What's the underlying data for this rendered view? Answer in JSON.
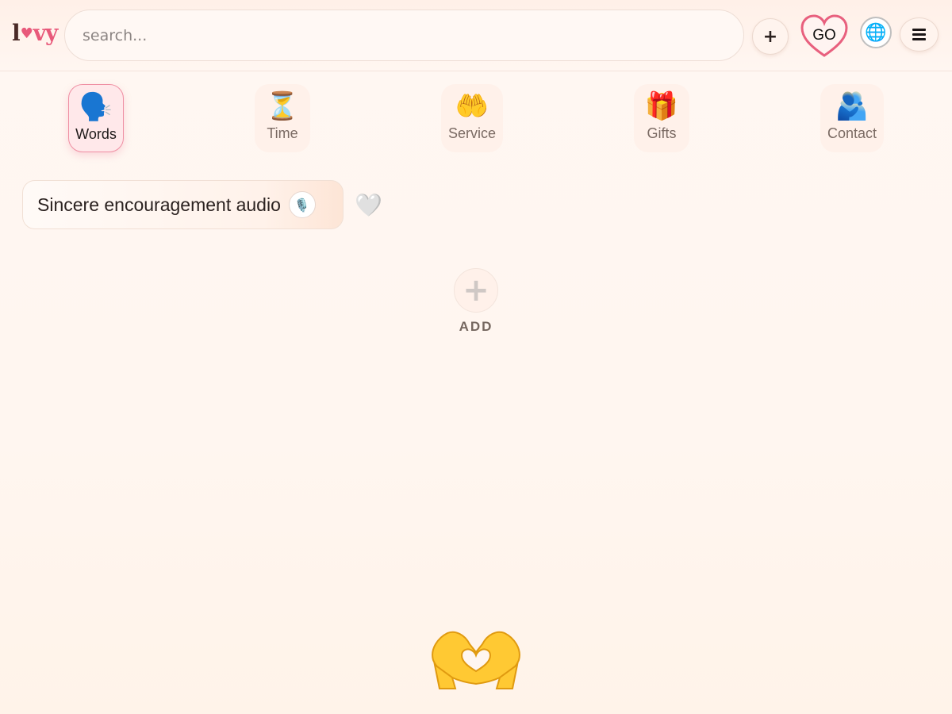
{
  "header": {
    "logo_l": "l",
    "logo_heart": "♥",
    "logo_rest": "vy",
    "search_placeholder": "search...",
    "plus_label": "+",
    "go_label": "GO",
    "globe_icon": "🌐"
  },
  "categories": [
    {
      "emoji": "🗣️",
      "label": "Words",
      "active": true
    },
    {
      "emoji": "⏳",
      "label": "Time",
      "active": false
    },
    {
      "emoji": "🤲",
      "label": "Service",
      "active": false
    },
    {
      "emoji": "🎁",
      "label": "Gifts",
      "active": false
    },
    {
      "emoji": "🫂",
      "label": "Contact",
      "active": false
    }
  ],
  "items": [
    {
      "text": "Sincere encouragement audio",
      "badge_icon": "🎙️",
      "favorite_icon": "🤍"
    }
  ],
  "add": {
    "icon": "+",
    "label": "ADD"
  },
  "colors": {
    "accent": "#e8597a",
    "background": "#fff6f0",
    "heart_yellow": "#ffcc33"
  }
}
